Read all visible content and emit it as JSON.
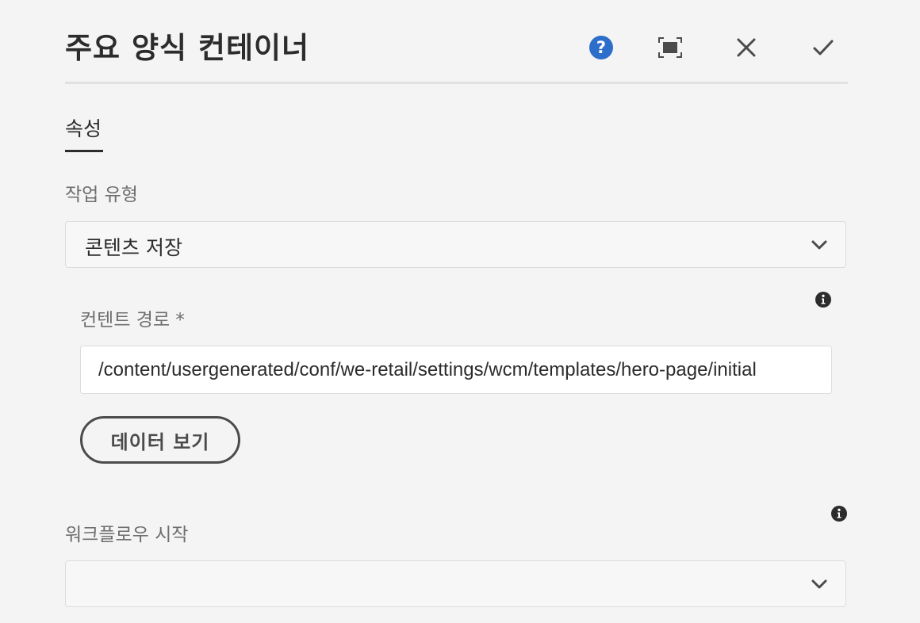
{
  "dialog": {
    "title": "주요 양식 컨테이너",
    "help_icon": "help-icon",
    "fullscreen_icon": "fullscreen-icon",
    "close_icon": "close-icon",
    "confirm_icon": "checkmark-icon",
    "accent_color": "#2c6ec9"
  },
  "tabs": [
    {
      "label": "속성",
      "selected": true
    }
  ],
  "action_type": {
    "label": "작업 유형",
    "value": "콘텐츠 저장"
  },
  "content_path": {
    "label": "컨텐트 경로 *",
    "value": "/content/usergenerated/conf/we-retail/settings/wcm/templates/hero-page/initial",
    "info_icon": "info-icon"
  },
  "view_data_button": {
    "label": "데이터 보기"
  },
  "start_workflow": {
    "label": "워크플로우 시작",
    "value": "",
    "info_icon": "info-icon"
  }
}
